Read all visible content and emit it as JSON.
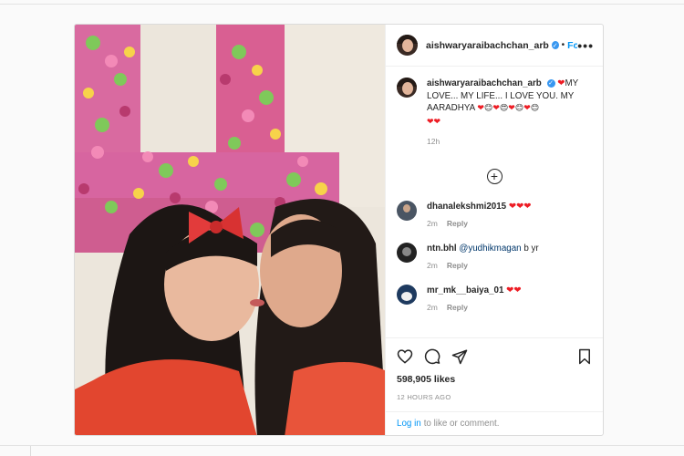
{
  "post": {
    "username": "aishwaryaraibachchan_arb",
    "dot": "•",
    "follow_label": "Follow",
    "more_label": "•••",
    "caption": {
      "username": "aishwaryaraibachchan_arb",
      "text": "MY LOVE... MY LIFE... I LOVE YOU. MY AARADHYA",
      "time": "12h"
    },
    "load_more_label": "+",
    "comments": [
      {
        "username": "dhanalekshmi2015",
        "text": "",
        "hearts": "❤❤❤",
        "time": "2m",
        "reply": "Reply"
      },
      {
        "username": "ntn.bhl",
        "mention": "@yudhikmagan",
        "text": "b yr",
        "time": "2m",
        "reply": "Reply"
      },
      {
        "username": "mr_mk__baiya_01",
        "text": "",
        "hearts": "❤❤",
        "time": "2m",
        "reply": "Reply"
      }
    ],
    "likes": "598,905 likes",
    "posted_ago": "12 HOURS AGO",
    "login_link": "Log in",
    "login_text": "to like or comment."
  },
  "icons": [
    "heart-icon",
    "comment-icon",
    "share-icon",
    "save-icon",
    "verified-icon",
    "add-circle-icon",
    "more-icon"
  ],
  "colors": {
    "link": "#0095f6",
    "heart": "#ed1c24",
    "verified": "#3897f0",
    "muted": "#8e8e8e"
  }
}
